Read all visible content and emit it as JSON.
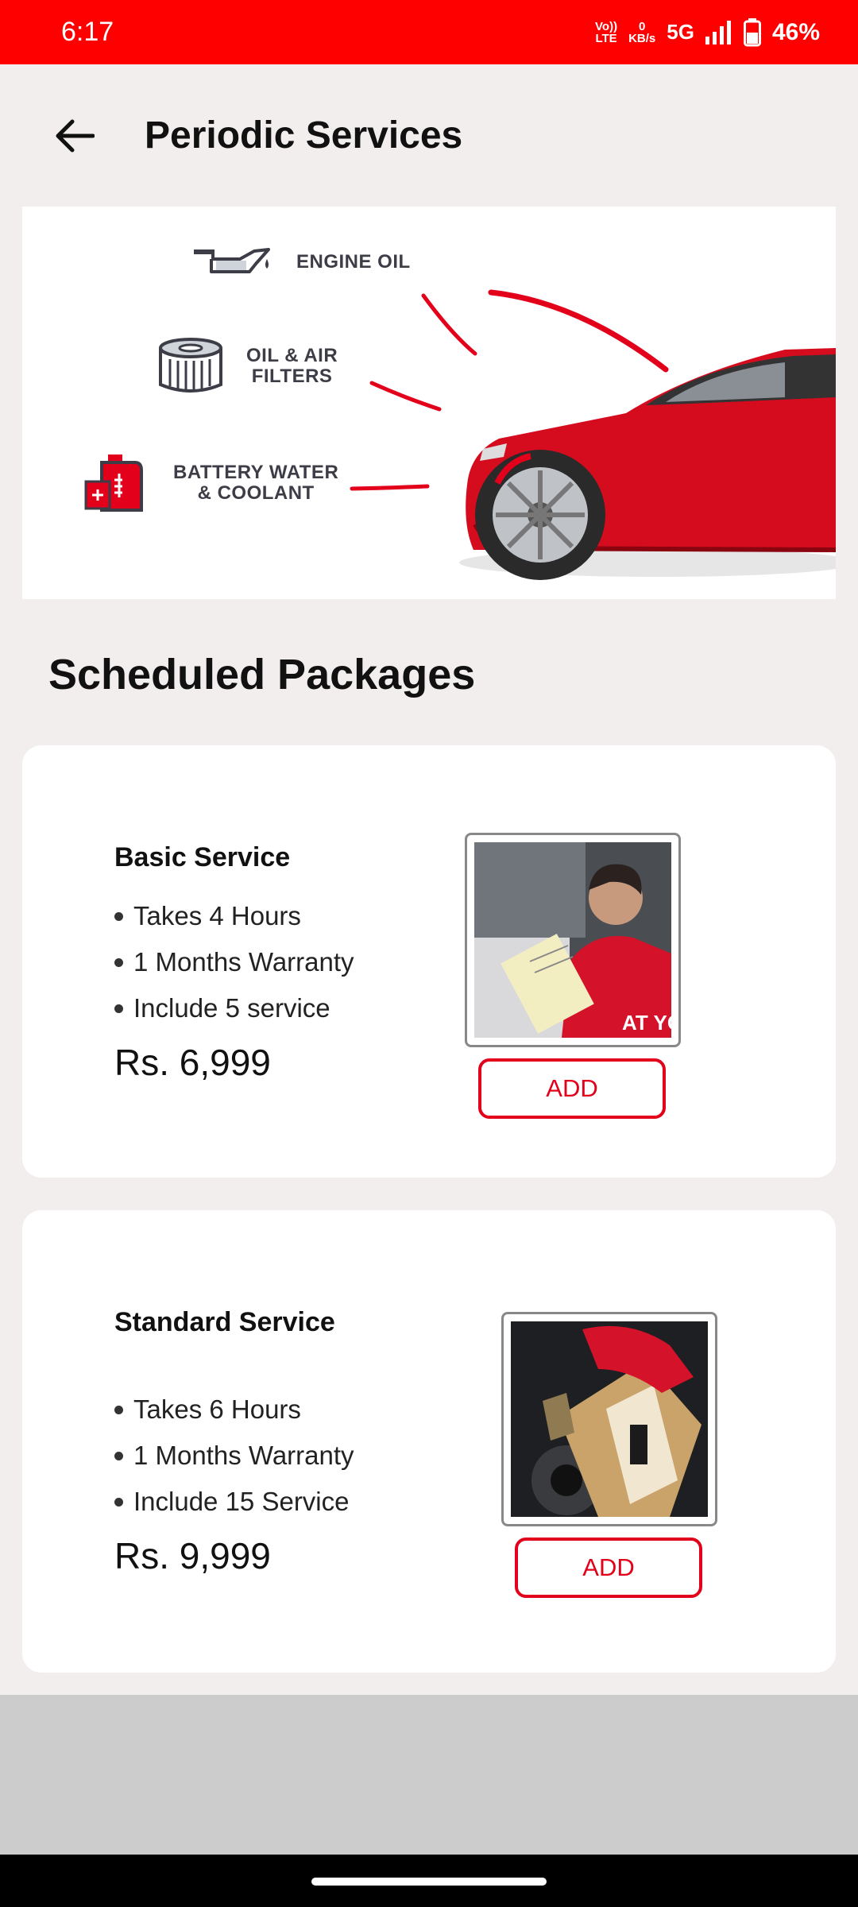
{
  "status_bar": {
    "time": "6:17",
    "volte_top": "Vo))",
    "volte_bottom": "LTE",
    "speed_top": "0",
    "speed_bottom": "KB/s",
    "network": "5G",
    "battery": "46%"
  },
  "app_bar": {
    "title": "Periodic Services",
    "back_icon": "arrow-left-icon"
  },
  "banner": {
    "features": [
      {
        "label": "ENGINE OIL",
        "icon": "oil-can-icon"
      },
      {
        "label": "OIL & AIR\nFILTERS",
        "icon": "filter-icon"
      },
      {
        "label": "BATTERY WATER\n& COOLANT",
        "icon": "coolant-can-icon"
      }
    ]
  },
  "section": {
    "title": "Scheduled Packages"
  },
  "packages": [
    {
      "title": "Basic Service",
      "features": [
        "Takes 4 Hours",
        "1 Months Warranty",
        "Include 5 service"
      ],
      "price": "Rs. 6,999",
      "add_label": "ADD"
    },
    {
      "title": "Standard Service",
      "features": [
        "Takes 6 Hours",
        "1 Months Warranty",
        "Include 15 Service"
      ],
      "price": "Rs. 9,999",
      "add_label": "ADD"
    }
  ],
  "colors": {
    "brand_red": "#ff0000",
    "button_red": "#e3001b",
    "background": "#f1eeed"
  }
}
